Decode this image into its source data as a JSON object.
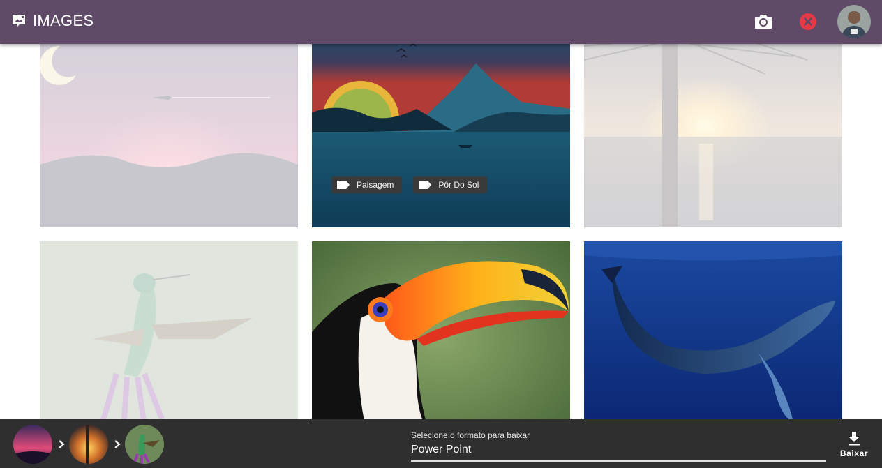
{
  "appbar": {
    "title": "IMAGES",
    "icons": [
      "add-image-icon",
      "camera-icon",
      "close-icon",
      "avatar"
    ],
    "accent_color": "#5f4b67",
    "close_color": "#e53946"
  },
  "gallery": {
    "items": [
      {
        "name": "moon-airplane-sunset",
        "selected": true
      },
      {
        "name": "mountain-lake-sunset",
        "selected": false,
        "tags": [
          "Paisagem",
          "Pôr Do Sol"
        ]
      },
      {
        "name": "palm-sea-sunset",
        "selected": true
      },
      {
        "name": "hummingbird",
        "selected": true
      },
      {
        "name": "toucan",
        "selected": false
      },
      {
        "name": "humpback-whale",
        "selected": false
      }
    ]
  },
  "bottombar": {
    "selected_thumbnails": [
      "moon-airplane-sunset",
      "palm-sea-sunset",
      "hummingbird"
    ],
    "format_label": "Selecione o formato para baixar",
    "format_value": "Power Point",
    "download_label": "Baixar"
  }
}
